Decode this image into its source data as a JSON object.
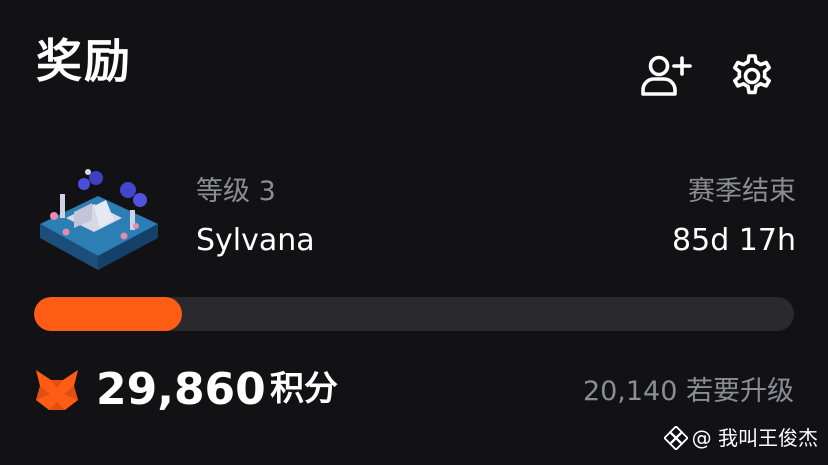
{
  "header": {
    "title": "奖励",
    "add_friend_icon": "person-add-icon",
    "settings_icon": "gear-icon"
  },
  "level": {
    "label": "等级 3",
    "name": "Sylvana",
    "season_label": "赛季结束",
    "season_remaining": "85d 17h",
    "progress": 0.195,
    "accent_color": "#ff5c16"
  },
  "points": {
    "icon": "metamask-fox-icon",
    "value": "29,860",
    "unit": "积分",
    "to_upgrade": "20,140 若要升级"
  },
  "watermark": {
    "text": "@ 我叫王俊杰"
  }
}
